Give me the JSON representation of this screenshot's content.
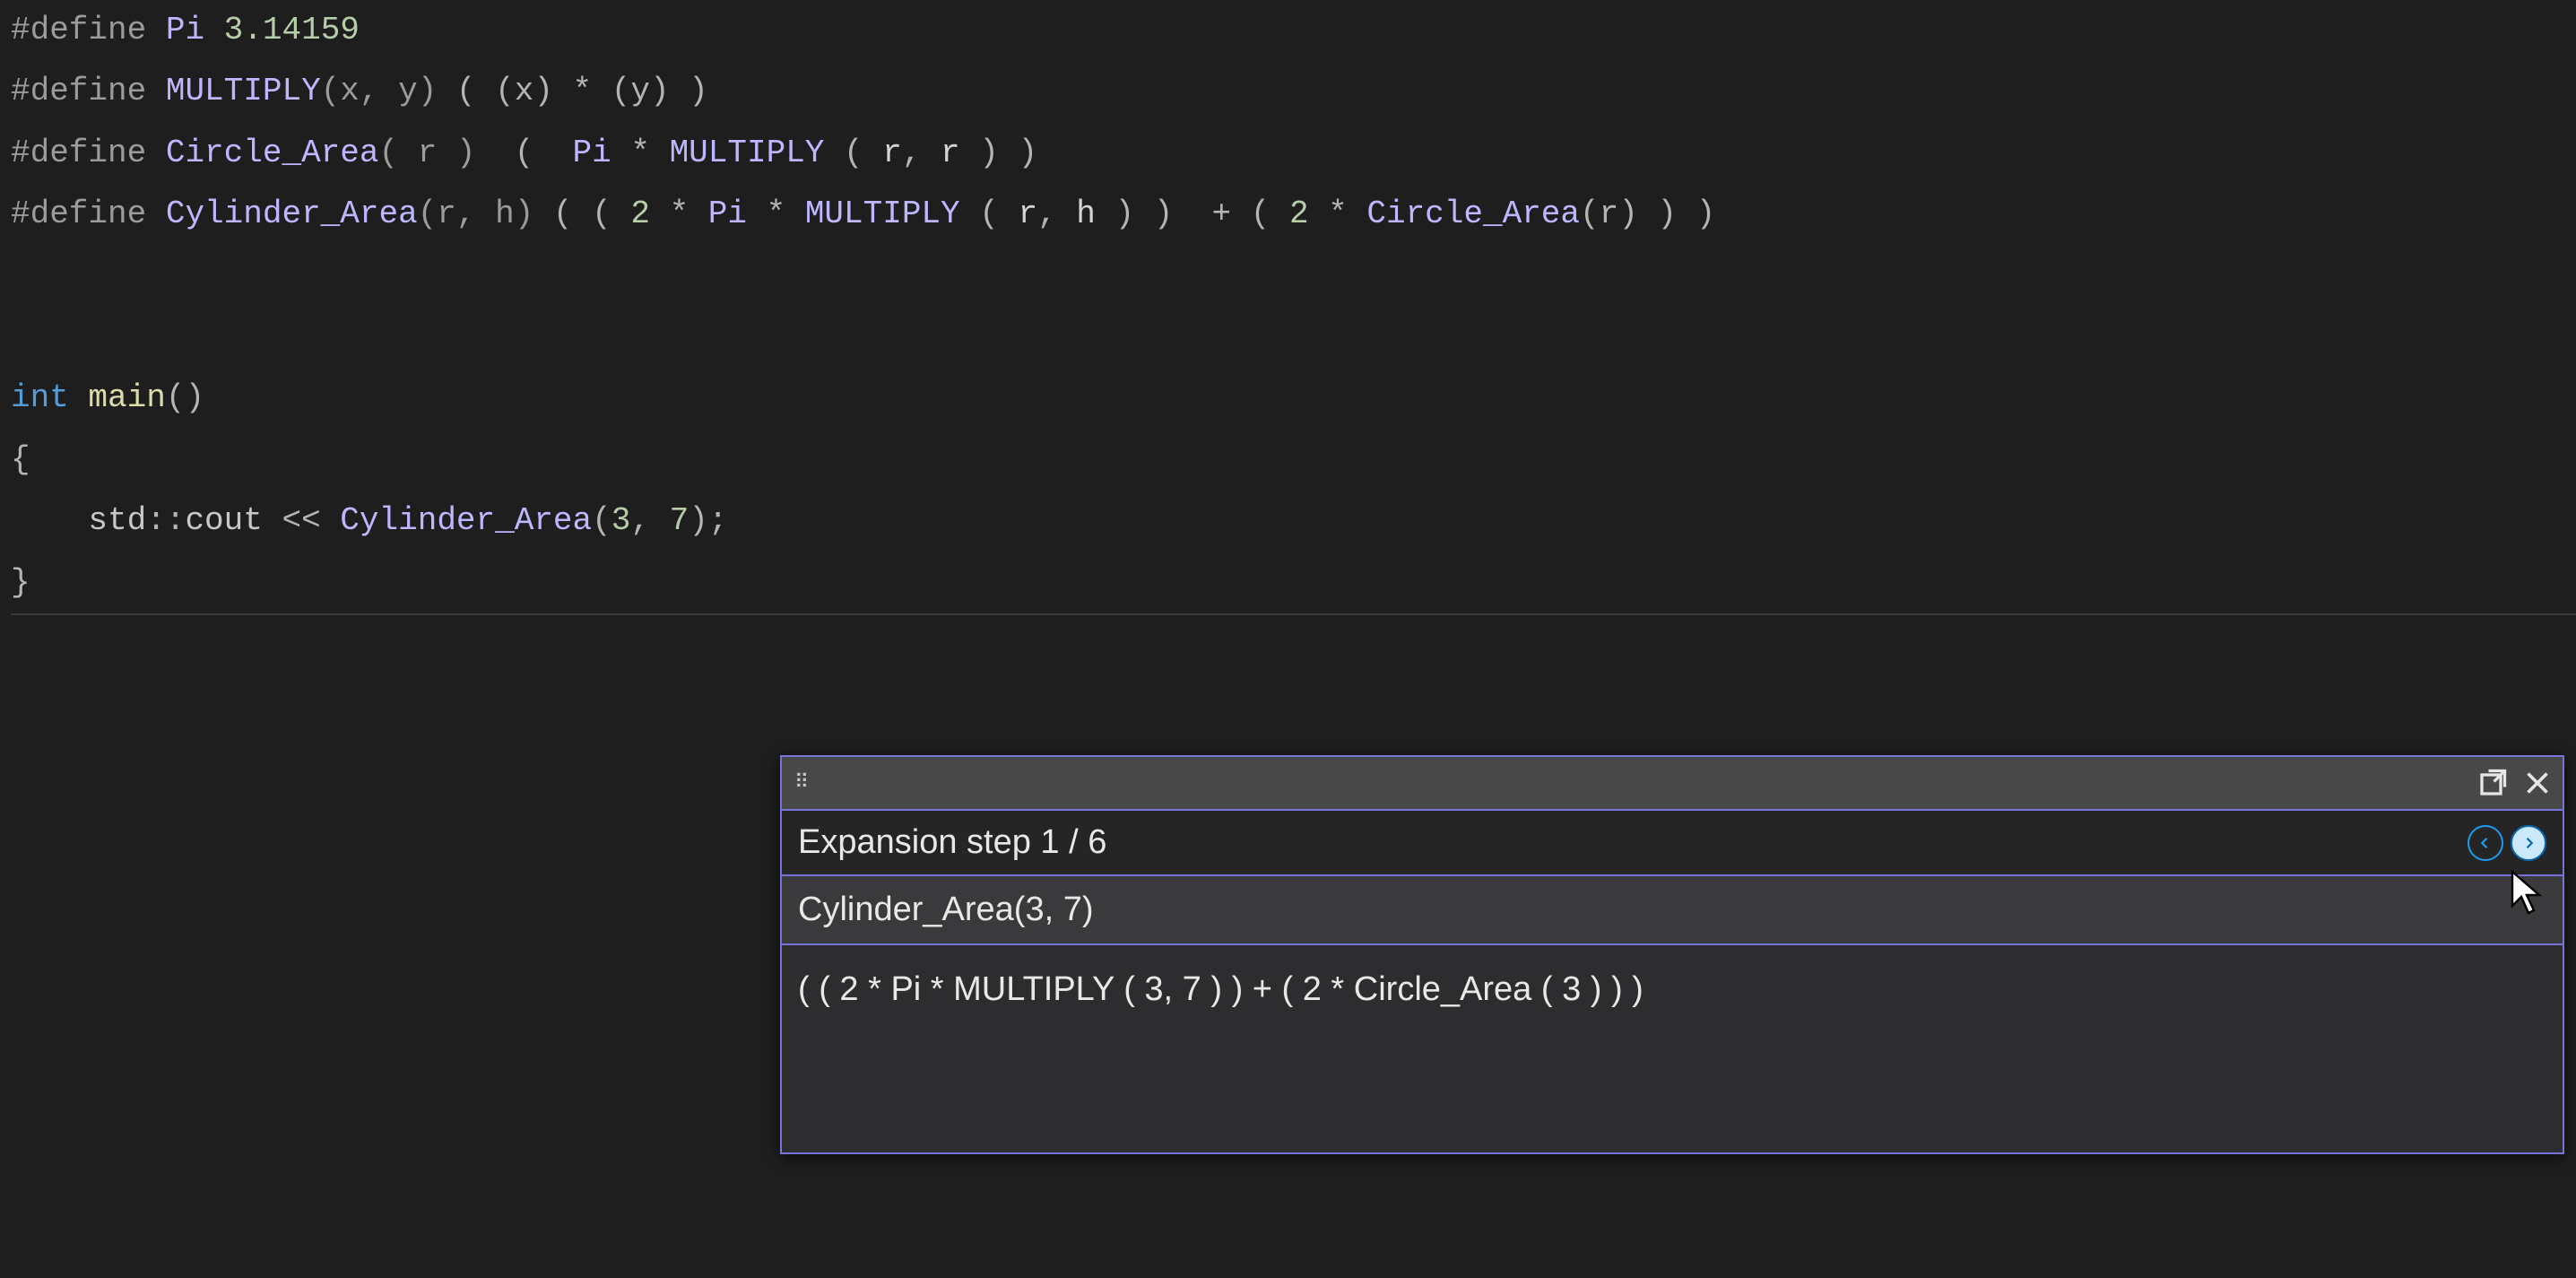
{
  "code": {
    "line1": {
      "define": "#define",
      "name": "Pi",
      "value": "3.14159"
    },
    "line2": {
      "define": "#define",
      "name": "MULTIPLY",
      "params": "(x, y)",
      "body_open": " ( ",
      "x": "(x)",
      "star": " * ",
      "y": "(y)",
      "body_close": " )"
    },
    "line3": {
      "define": "#define",
      "name": "Circle_Area",
      "params": "( r )",
      "gap": "  ",
      "open": "(  ",
      "pi": "Pi",
      "star": " * ",
      "mult": "MULTIPLY",
      "args_open": " ( ",
      "r1": "r",
      "comma": ", ",
      "r2": "r",
      "args_close": " ) ",
      "close": ")"
    },
    "line4": {
      "define": "#define",
      "name": "Cylinder_Area",
      "params": "(r, h)",
      "open": " ( ",
      "inner_open": "( ",
      "two": "2",
      "star1": " * ",
      "pi": "Pi",
      "star2": " * ",
      "mult": "MULTIPLY",
      "margs_open": " ( ",
      "r": "r",
      "comma": ", ",
      "h": "h",
      "margs_close": " ) ",
      "inner_close": ")",
      "gap": "  ",
      "plus": "+",
      "open2": " ( ",
      "two2": "2",
      "star3": " * ",
      "circ": "Circle_Area",
      "cargs": "(r)",
      "close2": " ) ",
      "close": ")"
    },
    "main": {
      "int": "int",
      "main": " main",
      "parens": "()",
      "open": "{",
      "std": "std",
      "scope": "::",
      "cout": "cout",
      "ins": " << ",
      "cyl": "Cylinder_Area",
      "args_open": "(",
      "a1": "3",
      "comma": ", ",
      "a2": "7",
      "args_close": ")",
      "semi": ";",
      "close": "}"
    }
  },
  "popup": {
    "step_label": "Expansion step ",
    "step_current": "1",
    "step_sep": " / ",
    "step_total": "6",
    "macro_call": "Cylinder_Area(3, 7)",
    "expansion": "( ( 2 * Pi * MULTIPLY ( 3, 7 ) ) + ( 2 * Circle_Area ( 3 ) ) )"
  }
}
